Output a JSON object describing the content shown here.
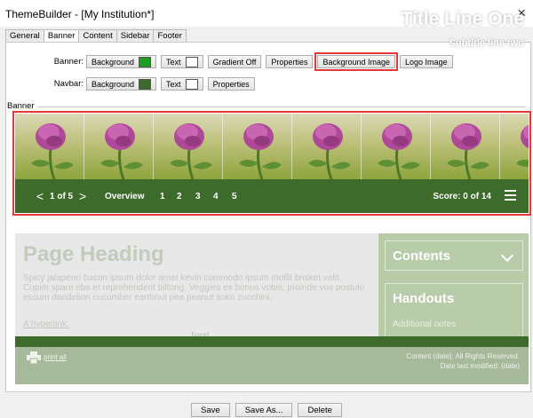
{
  "window": {
    "title": "ThemeBuilder - [My Institution*]",
    "close_glyph": "×"
  },
  "tabs": [
    "General",
    "Banner",
    "Content",
    "Sidebar",
    "Footer"
  ],
  "active_tab": "Banner",
  "banner_row": {
    "label": "Banner:",
    "background": "Background",
    "background_color": "#1e9e1e",
    "text": "Text",
    "text_color": "#ffffff",
    "gradient": "Gradient Off",
    "properties": "Properties",
    "background_image": "Background Image",
    "logo_image": "Logo Image"
  },
  "navbar_row": {
    "label": "Navbar:",
    "background": "Background",
    "background_color": "#3d6b2c",
    "text": "Text",
    "text_color": "#ffffff",
    "properties": "Properties"
  },
  "group_label": "Banner",
  "banner_preview": {
    "title": "Title Line One",
    "subtitle": "Subtitle line two",
    "image_subject": "clover-flower"
  },
  "navbar_preview": {
    "prev_glyph": "<",
    "page": "1 of 5",
    "next_glyph": ">",
    "overview": "Overview",
    "pages": [
      "1",
      "2",
      "3",
      "4",
      "5"
    ],
    "score": "Score: 0 of 14"
  },
  "page_preview": {
    "heading": "Page Heading",
    "body": "Spicy jalapeno bacon ipsum dolor amet kevin commodo ipsum mollit brisket velit. Cupim spare ribs et reprehenderit biltong. Veggies es bonus vobis, proinde vos postulo essum dandelion cucumber earthnut pea peanut soko zucchini.",
    "hyperlink": "A hyperlink.",
    "next": "Next",
    "sidebar_contents": "Contents",
    "sidebar_handouts": "Handouts",
    "additional_notes": "Additional notes",
    "print_all": "print all",
    "copyright_line1": "Content (date). All Rights Reserved.",
    "copyright_line2": "Date last modified: (date)"
  },
  "bottom_buttons": {
    "save": "Save",
    "save_as": "Save As...",
    "delete": "Delete"
  },
  "colors": {
    "highlight": "#e53838",
    "navbar_green": "#3d6b2c"
  }
}
